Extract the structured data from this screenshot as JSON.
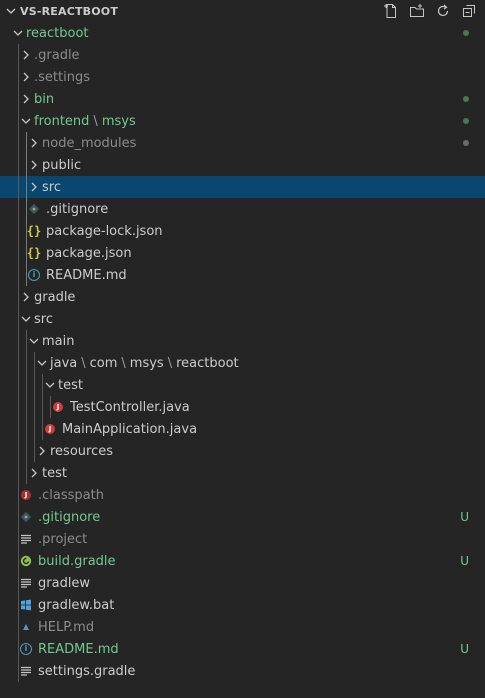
{
  "explorer": {
    "title": "VS-REACTBOOT",
    "actions": [
      "new-file-icon",
      "new-folder-icon",
      "refresh-icon",
      "collapse-all-icon"
    ]
  },
  "tree": [
    {
      "label": "reactboot",
      "kind": "folder",
      "open": true,
      "depth": 0,
      "color": "green",
      "deco": "dot-green"
    },
    {
      "label": ".gradle",
      "kind": "folder",
      "open": false,
      "depth": 1,
      "color": "dim"
    },
    {
      "label": ".settings",
      "kind": "folder",
      "open": false,
      "depth": 1,
      "color": "dim"
    },
    {
      "label": "bin",
      "kind": "folder",
      "open": false,
      "depth": 1,
      "color": "green",
      "deco": "dot-green"
    },
    {
      "label": "frontend",
      "label2": "msys",
      "kind": "folder",
      "open": true,
      "depth": 1,
      "color": "green",
      "deco": "dot-green"
    },
    {
      "label": "node_modules",
      "kind": "folder",
      "open": false,
      "depth": 2,
      "color": "dim",
      "deco": "dot-grey"
    },
    {
      "label": "public",
      "kind": "folder",
      "open": false,
      "depth": 2
    },
    {
      "label": "src",
      "kind": "folder",
      "open": false,
      "depth": 2,
      "selected": true
    },
    {
      "label": ".gitignore",
      "kind": "git",
      "depth": 2
    },
    {
      "label": "package-lock.json",
      "kind": "json",
      "depth": 2
    },
    {
      "label": "package.json",
      "kind": "json",
      "depth": 2
    },
    {
      "label": "README.md",
      "kind": "info",
      "depth": 2
    },
    {
      "label": "gradle",
      "kind": "folder",
      "open": false,
      "depth": 1
    },
    {
      "label": "src",
      "kind": "folder",
      "open": true,
      "depth": 1
    },
    {
      "label": "main",
      "kind": "folder",
      "open": true,
      "depth": 2
    },
    {
      "label": "java",
      "path": [
        "com",
        "msys",
        "reactboot"
      ],
      "kind": "folder",
      "open": true,
      "depth": 3
    },
    {
      "label": "test",
      "kind": "folder",
      "open": true,
      "depth": 4
    },
    {
      "label": "TestController.java",
      "kind": "java",
      "depth": 5
    },
    {
      "label": "MainApplication.java",
      "kind": "java",
      "depth": 4
    },
    {
      "label": "resources",
      "kind": "folder",
      "open": false,
      "depth": 3
    },
    {
      "label": "test",
      "kind": "folder",
      "open": false,
      "depth": 2
    },
    {
      "label": ".classpath",
      "kind": "java-dim",
      "depth": 1,
      "color": "dim"
    },
    {
      "label": ".gitignore",
      "kind": "git",
      "depth": 1,
      "color": "green",
      "deco": "U"
    },
    {
      "label": ".project",
      "kind": "lines",
      "depth": 1,
      "color": "dim"
    },
    {
      "label": "build.gradle",
      "kind": "gradle",
      "depth": 1,
      "color": "green",
      "deco": "U"
    },
    {
      "label": "gradlew",
      "kind": "lines",
      "depth": 1
    },
    {
      "label": "gradlew.bat",
      "kind": "windows",
      "depth": 1
    },
    {
      "label": "HELP.md",
      "kind": "md",
      "depth": 1,
      "color": "dim"
    },
    {
      "label": "README.md",
      "kind": "info",
      "depth": 1,
      "color": "green",
      "deco": "U"
    },
    {
      "label": "settings.gradle",
      "kind": "lines",
      "depth": 1
    }
  ]
}
